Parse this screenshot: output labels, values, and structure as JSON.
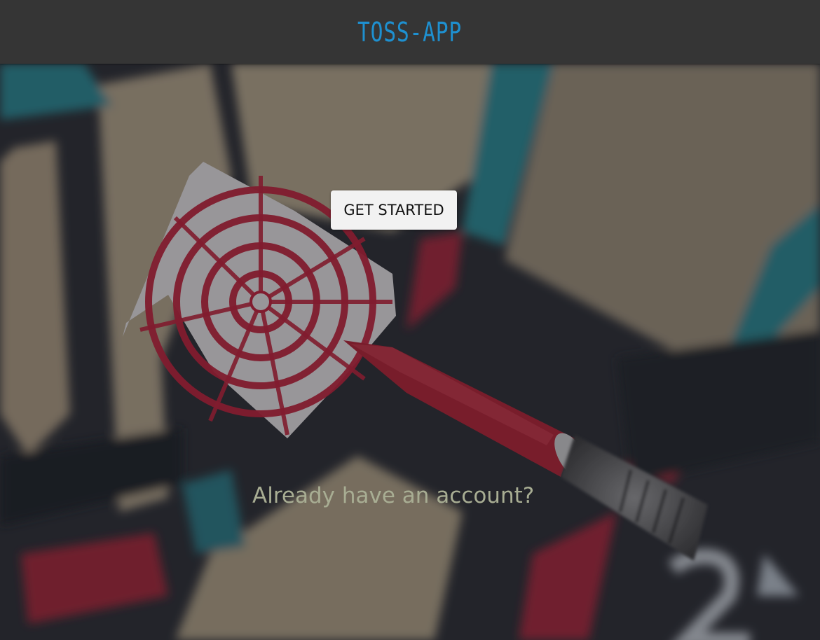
{
  "header": {
    "logo_text": "TOSS-APP",
    "logo_color": "#1e90d0",
    "background_color": "#353535"
  },
  "hero": {
    "background_image": "dartboard-with-dart-photo",
    "cta_label": "GET STARTED",
    "secondary_link": "Already have an account?",
    "secondary_link_color": "#a8ad93"
  }
}
